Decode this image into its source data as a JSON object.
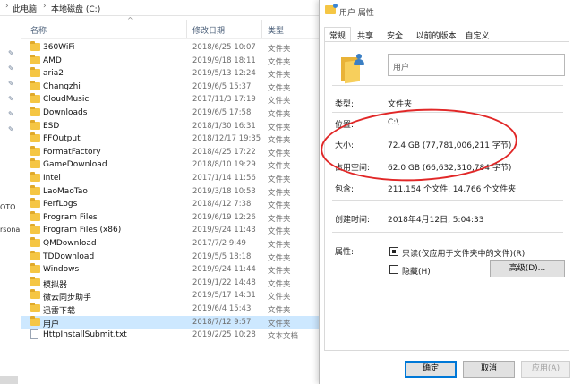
{
  "explorer": {
    "breadcrumb": [
      "此电脑",
      "本地磁盘 (C:)"
    ],
    "columns": {
      "name": "名称",
      "date": "修改日期",
      "type": "类型"
    },
    "nav_fragments": [
      "OTO",
      "rsona"
    ],
    "files": [
      {
        "name": "360WiFi",
        "date": "2018/6/25 10:07",
        "type": "文件夹",
        "kind": "folder"
      },
      {
        "name": "AMD",
        "date": "2019/9/18 18:11",
        "type": "文件夹",
        "kind": "folder"
      },
      {
        "name": "aria2",
        "date": "2019/5/13 12:24",
        "type": "文件夹",
        "kind": "folder"
      },
      {
        "name": "Changzhi",
        "date": "2019/6/5 15:37",
        "type": "文件夹",
        "kind": "folder"
      },
      {
        "name": "CloudMusic",
        "date": "2017/11/3 17:19",
        "type": "文件夹",
        "kind": "folder"
      },
      {
        "name": "Downloads",
        "date": "2019/6/5 17:58",
        "type": "文件夹",
        "kind": "folder"
      },
      {
        "name": "ESD",
        "date": "2018/1/30 16:31",
        "type": "文件夹",
        "kind": "folder"
      },
      {
        "name": "FFOutput",
        "date": "2018/12/17 19:35",
        "type": "文件夹",
        "kind": "folder"
      },
      {
        "name": "FormatFactory",
        "date": "2018/4/25 17:22",
        "type": "文件夹",
        "kind": "folder"
      },
      {
        "name": "GameDownload",
        "date": "2018/8/10 19:29",
        "type": "文件夹",
        "kind": "folder"
      },
      {
        "name": "Intel",
        "date": "2017/1/14 11:56",
        "type": "文件夹",
        "kind": "folder"
      },
      {
        "name": "LaoMaoTao",
        "date": "2019/3/18 10:53",
        "type": "文件夹",
        "kind": "folder"
      },
      {
        "name": "PerfLogs",
        "date": "2018/4/12 7:38",
        "type": "文件夹",
        "kind": "folder"
      },
      {
        "name": "Program Files",
        "date": "2019/6/19 12:26",
        "type": "文件夹",
        "kind": "folder"
      },
      {
        "name": "Program Files (x86)",
        "date": "2019/9/24 11:43",
        "type": "文件夹",
        "kind": "folder"
      },
      {
        "name": "QMDownload",
        "date": "2017/7/2 9:49",
        "type": "文件夹",
        "kind": "folder"
      },
      {
        "name": "TDDownload",
        "date": "2019/5/5 18:18",
        "type": "文件夹",
        "kind": "folder"
      },
      {
        "name": "Windows",
        "date": "2019/9/24 11:44",
        "type": "文件夹",
        "kind": "folder"
      },
      {
        "name": "模拟器",
        "date": "2019/1/22 14:48",
        "type": "文件夹",
        "kind": "folder"
      },
      {
        "name": "微云同步助手",
        "date": "2019/5/17 14:31",
        "type": "文件夹",
        "kind": "folder"
      },
      {
        "name": "迅雷下载",
        "date": "2019/6/4 15:43",
        "type": "文件夹",
        "kind": "folder"
      },
      {
        "name": "用户",
        "date": "2018/7/12 9:57",
        "type": "文件夹",
        "kind": "folder",
        "selected": true
      },
      {
        "name": "HttpInstallSubmit.txt",
        "date": "2019/2/25 10:28",
        "type": "文本文档",
        "kind": "doc"
      }
    ]
  },
  "dialog": {
    "title": "用户 属性",
    "tabs": [
      "常规",
      "共享",
      "安全",
      "以前的版本",
      "自定义"
    ],
    "active_tab": "常规",
    "folder_name": "用户",
    "rows": {
      "type_label": "类型:",
      "type_value": "文件夹",
      "location_label": "位置:",
      "location_value": "C:\\",
      "size_label": "大小:",
      "size_value": "72.4 GB (77,781,006,211 字节)",
      "disk_label": "占用空间:",
      "disk_value": "62.0 GB (66,632,310,784 字节)",
      "contains_label": "包含:",
      "contains_value": "211,154 个文件, 14,766 个文件夹",
      "created_label": "创建时间:",
      "created_value": "2018年4月12日, 5:04:33",
      "attrs_label": "属性:"
    },
    "readonly_label": "只读(仅应用于文件夹中的文件)(R)",
    "hidden_label": "隐藏(H)",
    "advanced_label": "高级(D)...",
    "buttons": {
      "ok": "确定",
      "cancel": "取消",
      "apply": "应用(A)"
    }
  },
  "colors": {
    "selection": "#cde8ff",
    "annotation": "#e12727",
    "accent": "#0078d7"
  }
}
